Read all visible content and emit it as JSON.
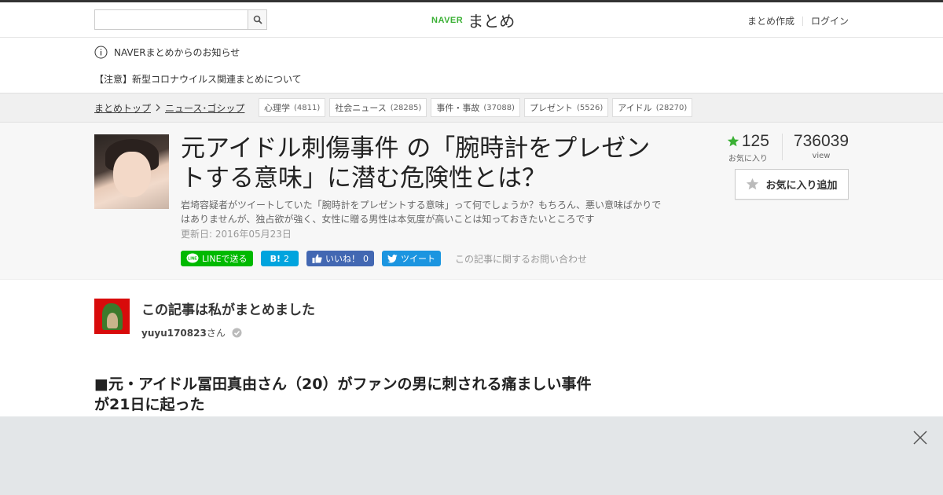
{
  "header": {
    "search_placeholder": "",
    "logo_brand": "NAVER",
    "logo_name": "まとめ",
    "links": [
      "まとめ作成",
      "ログイン"
    ]
  },
  "notice": {
    "title": "NAVERまとめからのお知らせ",
    "message": "【注意】新型コロナウイルス関連まとめについて"
  },
  "breadcrumb": {
    "items": [
      "まとめトップ",
      "ニュース･ゴシップ"
    ],
    "tags": [
      {
        "label": "心理学",
        "count": "(4811)"
      },
      {
        "label": "社会ニュース",
        "count": "(28285)"
      },
      {
        "label": "事件・事故",
        "count": "(37088)"
      },
      {
        "label": "プレゼント",
        "count": "(5526)"
      },
      {
        "label": "アイドル",
        "count": "(28270)"
      }
    ]
  },
  "article": {
    "title": "元アイドル刺傷事件 の「腕時計をプレゼントする意味」に潜む危険性とは？",
    "description": "岩埼容疑者がツイートしていた「腕時計をプレゼントする意味」って何でしょうか？もちろん、悪い意味ばかりではありませんが、独占欲が強く、女性に贈る男性は本気度が高いことは知っておきたいところです",
    "updated": "更新日: 2016年05月23日",
    "social": {
      "line": "LINEで送る",
      "hatena_count": "2",
      "fb_label": "いいね！",
      "fb_count": "0",
      "tweet": "ツイート",
      "contact": "この記事に関するお問い合わせ"
    },
    "stats": {
      "favorites": "125",
      "favorites_label": "お気に入り",
      "views": "736039",
      "views_label": "view"
    },
    "fav_button": "お気に入り追加"
  },
  "author": {
    "heading": "この記事は私がまとめました",
    "name": "yuyu170823",
    "suffix": "さん"
  },
  "section_heading": "■元・アイドル冨田真由さん（20）がファンの男に刺される痛ましい事件が21日に起った",
  "colors": {
    "naver_green": "#3ab034",
    "line_green": "#00b900",
    "hatena_blue": "#00a4de",
    "fb_blue": "#4267b2",
    "twitter_blue": "#1b95e0",
    "star_green": "#3ab034"
  }
}
